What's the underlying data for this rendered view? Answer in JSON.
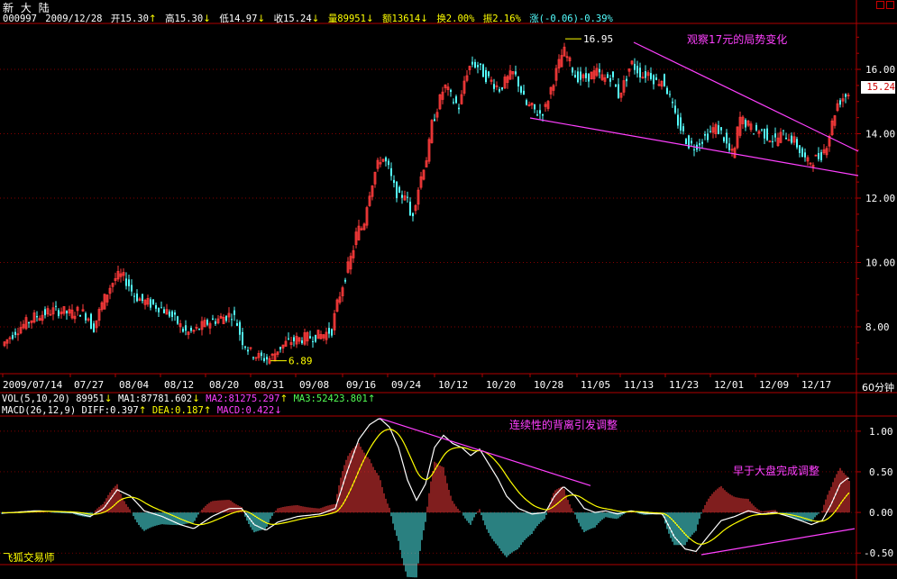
{
  "title": "新 大 陆",
  "quote": {
    "code": "000997",
    "date": "2009/12/28",
    "open": "开15.30",
    "open_arrow": "↑",
    "high": "高15.30",
    "high_arrow": "↓",
    "low": "低14.97",
    "low_arrow": "↓",
    "close": "收15.24",
    "close_arrow": "↓",
    "volume": "量89951",
    "volume_arrow": "↓",
    "amount": "额13614",
    "amount_arrow": "↓",
    "turnover": "换2.00%",
    "amplitude": "振2.16%",
    "change": "涨(-0.06)-0.39%"
  },
  "vol_indicator": {
    "name": "VOL(5,10,20)",
    "value": "89951",
    "v_arrow": "↓",
    "ma1": "MA1:87781.602",
    "ma1_arrow": "↓",
    "ma2": "MA2:81275.297",
    "ma2_arrow": "↑",
    "ma3": "MA3:52423.801",
    "ma3_arrow": "↑"
  },
  "macd_indicator": {
    "name": "MACD(26,12,9)",
    "diff": "DIFF:0.397",
    "diff_arrow": "↑",
    "dea": "DEA:0.187",
    "dea_arrow": "↑",
    "macd": "MACD:0.422",
    "macd_arrow": "↓"
  },
  "timeframe": "60分钟",
  "footer": "飞狐交易师",
  "current_price": "15.24",
  "colors": {
    "up": "#ff3b3b",
    "down": "#54ffff",
    "annotation": "#ff40ff",
    "axis": "#b00000",
    "yellow": "#ffff00",
    "white": "#ffffff"
  },
  "chart_data": [
    {
      "type": "candlestick",
      "x_labels": [
        "2009/07/14",
        "07/27",
        "08/04",
        "08/12",
        "08/20",
        "08/31",
        "09/08",
        "09/16",
        "09/24",
        "10/12",
        "10/20",
        "10/28",
        "11/05",
        "11/13",
        "11/23",
        "12/01",
        "12/09",
        "12/17"
      ],
      "y_ticks": [
        "16.00",
        "14.00",
        "12.00",
        "10.00",
        "8.00"
      ],
      "ylim": [
        6.6,
        17.4
      ],
      "price_path": [
        [
          0,
          7.3
        ],
        [
          10,
          7.6
        ],
        [
          20,
          7.9
        ],
        [
          30,
          8.1
        ],
        [
          40,
          8.3
        ],
        [
          50,
          8.4
        ],
        [
          60,
          8.5
        ],
        [
          70,
          8.5
        ],
        [
          80,
          8.4
        ],
        [
          90,
          8.5
        ],
        [
          100,
          8.3
        ],
        [
          105,
          7.9
        ],
        [
          110,
          8.3
        ],
        [
          115,
          8.7
        ],
        [
          120,
          9.0
        ],
        [
          125,
          9.3
        ],
        [
          130,
          9.5
        ],
        [
          135,
          9.6
        ],
        [
          140,
          9.5
        ],
        [
          145,
          9.3
        ],
        [
          150,
          9.0
        ],
        [
          160,
          8.8
        ],
        [
          170,
          8.7
        ],
        [
          180,
          8.6
        ],
        [
          190,
          8.4
        ],
        [
          200,
          8.1
        ],
        [
          205,
          7.9
        ],
        [
          210,
          7.8
        ],
        [
          220,
          7.9
        ],
        [
          230,
          8.1
        ],
        [
          240,
          8.2
        ],
        [
          250,
          8.3
        ],
        [
          260,
          8.4
        ],
        [
          265,
          8.1
        ],
        [
          270,
          7.6
        ],
        [
          275,
          7.4
        ],
        [
          280,
          7.2
        ],
        [
          290,
          7.05
        ],
        [
          300,
          7.0
        ],
        [
          305,
          7.1
        ],
        [
          310,
          7.3
        ],
        [
          320,
          7.5
        ],
        [
          330,
          7.6
        ],
        [
          340,
          7.65
        ],
        [
          350,
          7.7
        ],
        [
          360,
          7.75
        ],
        [
          370,
          7.9
        ],
        [
          375,
          8.6
        ],
        [
          383,
          9.4
        ],
        [
          393,
          10.3
        ],
        [
          398,
          11.0
        ],
        [
          405,
          11.1
        ],
        [
          410,
          12.0
        ],
        [
          418,
          12.8
        ],
        [
          425,
          13.3
        ],
        [
          432,
          13.0
        ],
        [
          438,
          12.4
        ],
        [
          445,
          12.0
        ],
        [
          452,
          12.2
        ],
        [
          458,
          11.3
        ],
        [
          465,
          12.2
        ],
        [
          472,
          13.0
        ],
        [
          477,
          13.4
        ],
        [
          480,
          14.2
        ],
        [
          487,
          14.8
        ],
        [
          495,
          15.5
        ],
        [
          503,
          15.1
        ],
        [
          512,
          14.8
        ],
        [
          518,
          15.8
        ],
        [
          525,
          16.2
        ],
        [
          532,
          16.1
        ],
        [
          540,
          15.8
        ],
        [
          548,
          15.6
        ],
        [
          556,
          15.4
        ],
        [
          565,
          15.7
        ],
        [
          572,
          15.9
        ],
        [
          578,
          15.5
        ],
        [
          585,
          14.9
        ],
        [
          592,
          14.8
        ],
        [
          600,
          14.6
        ],
        [
          607,
          14.8
        ],
        [
          614,
          15.5
        ],
        [
          620,
          16.0
        ],
        [
          627,
          16.6
        ],
        [
          634,
          16.2
        ],
        [
          640,
          15.8
        ],
        [
          648,
          15.7
        ],
        [
          656,
          15.8
        ],
        [
          664,
          15.9
        ],
        [
          672,
          15.7
        ],
        [
          680,
          15.8
        ],
        [
          688,
          15.2
        ],
        [
          695,
          15.6
        ],
        [
          702,
          16.2
        ],
        [
          708,
          16.0
        ],
        [
          715,
          15.8
        ],
        [
          722,
          15.9
        ],
        [
          730,
          15.6
        ],
        [
          737,
          15.7
        ],
        [
          744,
          15.2
        ],
        [
          750,
          14.6
        ],
        [
          758,
          14.1
        ],
        [
          765,
          13.7
        ],
        [
          772,
          13.6
        ],
        [
          780,
          13.8
        ],
        [
          788,
          14.0
        ],
        [
          795,
          14.2
        ],
        [
          803,
          14.0
        ],
        [
          810,
          13.5
        ],
        [
          816,
          13.3
        ],
        [
          822,
          14.5
        ],
        [
          830,
          14.3
        ],
        [
          838,
          14.1
        ],
        [
          846,
          14.1
        ],
        [
          854,
          13.9
        ],
        [
          862,
          13.8
        ],
        [
          870,
          14.0
        ],
        [
          878,
          13.9
        ],
        [
          885,
          13.7
        ],
        [
          892,
          13.3
        ],
        [
          898,
          13.1
        ],
        [
          905,
          13.2
        ],
        [
          912,
          13.3
        ],
        [
          918,
          13.6
        ],
        [
          924,
          14.2
        ],
        [
          930,
          14.9
        ],
        [
          936,
          15.1
        ],
        [
          942,
          15.24
        ]
      ],
      "annotations": [
        {
          "text": "16.95",
          "value": 16.95
        },
        {
          "text": "6.89",
          "value": 6.89
        },
        {
          "text": "观察17元的局势变化"
        }
      ]
    },
    {
      "type": "macd",
      "y_ticks": [
        "1.00",
        "0.50",
        "0.00",
        "-0.50"
      ],
      "ylim": [
        -0.62,
        1.22
      ],
      "annotations": [
        {
          "text": "连续性的背离引发调整"
        },
        {
          "text": "早于大盘完成调整"
        }
      ]
    }
  ]
}
